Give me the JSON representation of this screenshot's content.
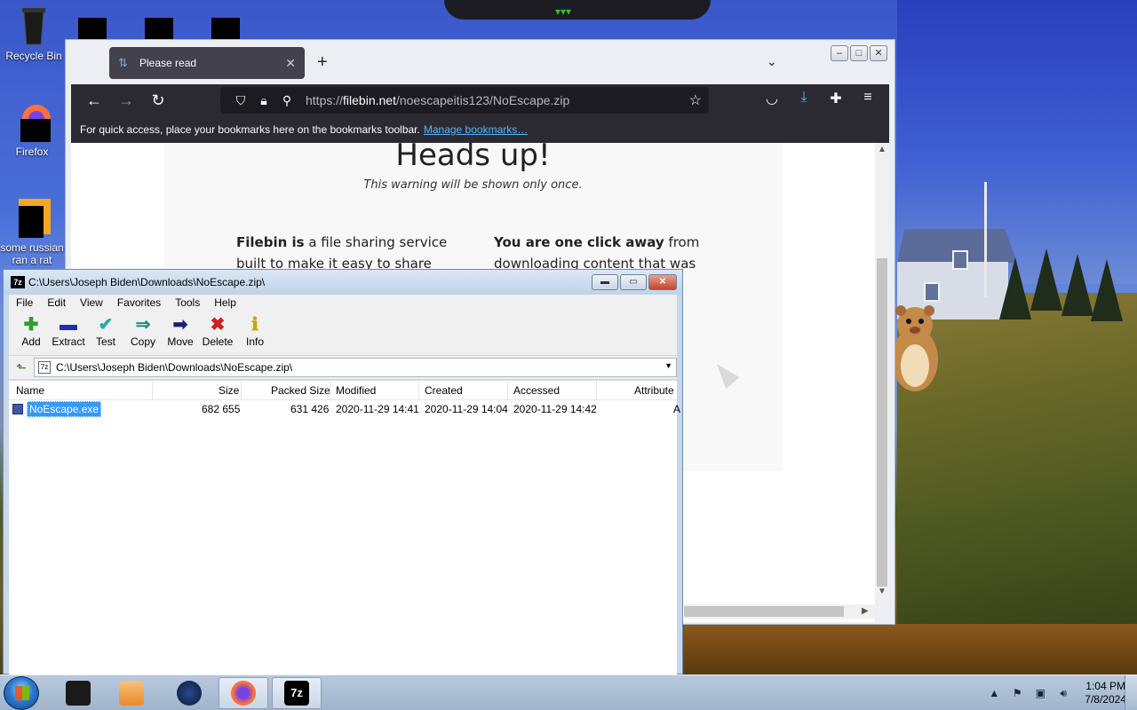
{
  "desktop": {
    "icons": [
      {
        "label": "Recycle Bin"
      },
      {
        "label": "Firefox"
      },
      {
        "label": "some russian ran a rat"
      }
    ]
  },
  "firefox": {
    "tab_title": "Please read",
    "url_scheme": "https://",
    "url_host": "filebin.net",
    "url_path": "/noescapeitis123/NoEscape.zip",
    "bookmarks_prompt": "For quick access, place your bookmarks here on the bookmarks toolbar.",
    "bookmarks_link": "Manage bookmarks…",
    "page": {
      "heading": "Heads up!",
      "subheading": "This warning will be shown only once.",
      "left_bold": "Filebin is",
      "left_text": " a file sharing service built to make it easy to share files",
      "right_bold": "You are one click away",
      "right_text": " from downloading content that was"
    }
  },
  "sevenzip": {
    "title": "C:\\Users\\Joseph Biden\\Downloads\\NoEscape.zip\\",
    "menu": [
      "File",
      "Edit",
      "View",
      "Favorites",
      "Tools",
      "Help"
    ],
    "toolbar": [
      {
        "label": "Add",
        "icon": "plus-icon",
        "color": "#2aa02a"
      },
      {
        "label": "Extract",
        "icon": "minus-icon",
        "color": "#1f2fb0"
      },
      {
        "label": "Test",
        "icon": "check-icon",
        "color": "#29a9a9"
      },
      {
        "label": "Copy",
        "icon": "copy-arrows-icon",
        "color": "#1b8a8a"
      },
      {
        "label": "Move",
        "icon": "arrow-right-icon",
        "color": "#1a1f7a"
      },
      {
        "label": "Delete",
        "icon": "x-icon",
        "color": "#d21f1f"
      },
      {
        "label": "Info",
        "icon": "info-icon",
        "color": "#c8a400"
      }
    ],
    "path": "C:\\Users\\Joseph Biden\\Downloads\\NoEscape.zip\\",
    "columns": [
      "Name",
      "Size",
      "Packed Size",
      "Modified",
      "Created",
      "Accessed",
      "Attribute"
    ],
    "rows": [
      {
        "name": "NoEscape.exe",
        "size": "682 655",
        "packed": "631 426",
        "modified": "2020-11-29 14:41",
        "created": "2020-11-29 14:04",
        "accessed": "2020-11-29 14:42",
        "attr": "A"
      }
    ]
  },
  "taskbar": {
    "items": [
      "terminal",
      "media-player",
      "tor-browser",
      "firefox",
      "7-zip"
    ],
    "sevenzip_label": "7z",
    "time": "1:04 PM",
    "date": "7/8/2024"
  }
}
